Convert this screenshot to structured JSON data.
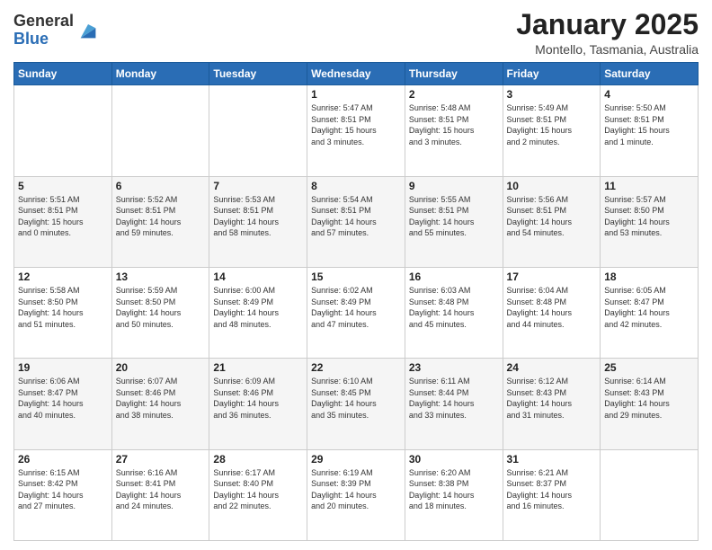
{
  "logo": {
    "general": "General",
    "blue": "Blue"
  },
  "header": {
    "month": "January 2025",
    "location": "Montello, Tasmania, Australia"
  },
  "weekdays": [
    "Sunday",
    "Monday",
    "Tuesday",
    "Wednesday",
    "Thursday",
    "Friday",
    "Saturday"
  ],
  "weeks": [
    [
      {
        "day": "",
        "info": ""
      },
      {
        "day": "",
        "info": ""
      },
      {
        "day": "",
        "info": ""
      },
      {
        "day": "1",
        "info": "Sunrise: 5:47 AM\nSunset: 8:51 PM\nDaylight: 15 hours\nand 3 minutes."
      },
      {
        "day": "2",
        "info": "Sunrise: 5:48 AM\nSunset: 8:51 PM\nDaylight: 15 hours\nand 3 minutes."
      },
      {
        "day": "3",
        "info": "Sunrise: 5:49 AM\nSunset: 8:51 PM\nDaylight: 15 hours\nand 2 minutes."
      },
      {
        "day": "4",
        "info": "Sunrise: 5:50 AM\nSunset: 8:51 PM\nDaylight: 15 hours\nand 1 minute."
      }
    ],
    [
      {
        "day": "5",
        "info": "Sunrise: 5:51 AM\nSunset: 8:51 PM\nDaylight: 15 hours\nand 0 minutes."
      },
      {
        "day": "6",
        "info": "Sunrise: 5:52 AM\nSunset: 8:51 PM\nDaylight: 14 hours\nand 59 minutes."
      },
      {
        "day": "7",
        "info": "Sunrise: 5:53 AM\nSunset: 8:51 PM\nDaylight: 14 hours\nand 58 minutes."
      },
      {
        "day": "8",
        "info": "Sunrise: 5:54 AM\nSunset: 8:51 PM\nDaylight: 14 hours\nand 57 minutes."
      },
      {
        "day": "9",
        "info": "Sunrise: 5:55 AM\nSunset: 8:51 PM\nDaylight: 14 hours\nand 55 minutes."
      },
      {
        "day": "10",
        "info": "Sunrise: 5:56 AM\nSunset: 8:51 PM\nDaylight: 14 hours\nand 54 minutes."
      },
      {
        "day": "11",
        "info": "Sunrise: 5:57 AM\nSunset: 8:50 PM\nDaylight: 14 hours\nand 53 minutes."
      }
    ],
    [
      {
        "day": "12",
        "info": "Sunrise: 5:58 AM\nSunset: 8:50 PM\nDaylight: 14 hours\nand 51 minutes."
      },
      {
        "day": "13",
        "info": "Sunrise: 5:59 AM\nSunset: 8:50 PM\nDaylight: 14 hours\nand 50 minutes."
      },
      {
        "day": "14",
        "info": "Sunrise: 6:00 AM\nSunset: 8:49 PM\nDaylight: 14 hours\nand 48 minutes."
      },
      {
        "day": "15",
        "info": "Sunrise: 6:02 AM\nSunset: 8:49 PM\nDaylight: 14 hours\nand 47 minutes."
      },
      {
        "day": "16",
        "info": "Sunrise: 6:03 AM\nSunset: 8:48 PM\nDaylight: 14 hours\nand 45 minutes."
      },
      {
        "day": "17",
        "info": "Sunrise: 6:04 AM\nSunset: 8:48 PM\nDaylight: 14 hours\nand 44 minutes."
      },
      {
        "day": "18",
        "info": "Sunrise: 6:05 AM\nSunset: 8:47 PM\nDaylight: 14 hours\nand 42 minutes."
      }
    ],
    [
      {
        "day": "19",
        "info": "Sunrise: 6:06 AM\nSunset: 8:47 PM\nDaylight: 14 hours\nand 40 minutes."
      },
      {
        "day": "20",
        "info": "Sunrise: 6:07 AM\nSunset: 8:46 PM\nDaylight: 14 hours\nand 38 minutes."
      },
      {
        "day": "21",
        "info": "Sunrise: 6:09 AM\nSunset: 8:46 PM\nDaylight: 14 hours\nand 36 minutes."
      },
      {
        "day": "22",
        "info": "Sunrise: 6:10 AM\nSunset: 8:45 PM\nDaylight: 14 hours\nand 35 minutes."
      },
      {
        "day": "23",
        "info": "Sunrise: 6:11 AM\nSunset: 8:44 PM\nDaylight: 14 hours\nand 33 minutes."
      },
      {
        "day": "24",
        "info": "Sunrise: 6:12 AM\nSunset: 8:43 PM\nDaylight: 14 hours\nand 31 minutes."
      },
      {
        "day": "25",
        "info": "Sunrise: 6:14 AM\nSunset: 8:43 PM\nDaylight: 14 hours\nand 29 minutes."
      }
    ],
    [
      {
        "day": "26",
        "info": "Sunrise: 6:15 AM\nSunset: 8:42 PM\nDaylight: 14 hours\nand 27 minutes."
      },
      {
        "day": "27",
        "info": "Sunrise: 6:16 AM\nSunset: 8:41 PM\nDaylight: 14 hours\nand 24 minutes."
      },
      {
        "day": "28",
        "info": "Sunrise: 6:17 AM\nSunset: 8:40 PM\nDaylight: 14 hours\nand 22 minutes."
      },
      {
        "day": "29",
        "info": "Sunrise: 6:19 AM\nSunset: 8:39 PM\nDaylight: 14 hours\nand 20 minutes."
      },
      {
        "day": "30",
        "info": "Sunrise: 6:20 AM\nSunset: 8:38 PM\nDaylight: 14 hours\nand 18 minutes."
      },
      {
        "day": "31",
        "info": "Sunrise: 6:21 AM\nSunset: 8:37 PM\nDaylight: 14 hours\nand 16 minutes."
      },
      {
        "day": "",
        "info": ""
      }
    ]
  ]
}
